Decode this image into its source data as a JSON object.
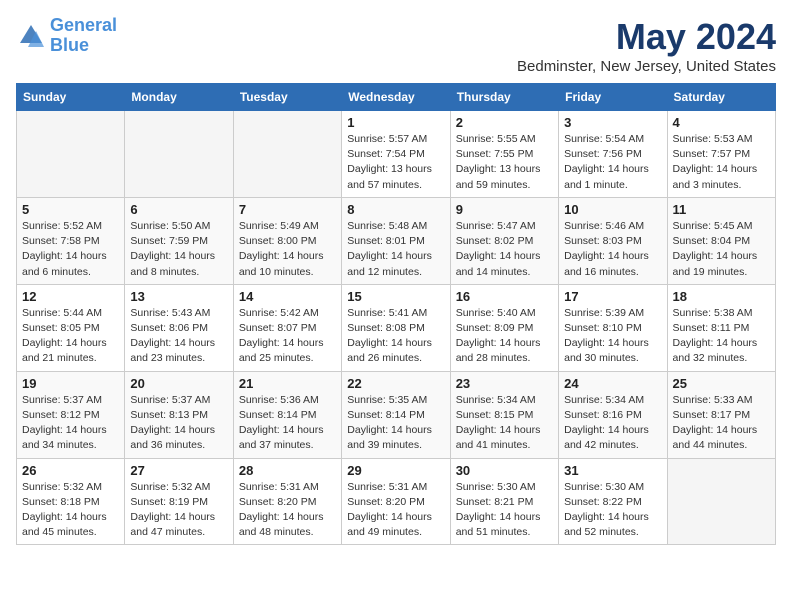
{
  "header": {
    "logo_line1": "General",
    "logo_line2": "Blue",
    "month": "May 2024",
    "location": "Bedminster, New Jersey, United States"
  },
  "weekdays": [
    "Sunday",
    "Monday",
    "Tuesday",
    "Wednesday",
    "Thursday",
    "Friday",
    "Saturday"
  ],
  "weeks": [
    [
      {
        "day": "",
        "info": ""
      },
      {
        "day": "",
        "info": ""
      },
      {
        "day": "",
        "info": ""
      },
      {
        "day": "1",
        "info": "Sunrise: 5:57 AM\nSunset: 7:54 PM\nDaylight: 13 hours\nand 57 minutes."
      },
      {
        "day": "2",
        "info": "Sunrise: 5:55 AM\nSunset: 7:55 PM\nDaylight: 13 hours\nand 59 minutes."
      },
      {
        "day": "3",
        "info": "Sunrise: 5:54 AM\nSunset: 7:56 PM\nDaylight: 14 hours\nand 1 minute."
      },
      {
        "day": "4",
        "info": "Sunrise: 5:53 AM\nSunset: 7:57 PM\nDaylight: 14 hours\nand 3 minutes."
      }
    ],
    [
      {
        "day": "5",
        "info": "Sunrise: 5:52 AM\nSunset: 7:58 PM\nDaylight: 14 hours\nand 6 minutes."
      },
      {
        "day": "6",
        "info": "Sunrise: 5:50 AM\nSunset: 7:59 PM\nDaylight: 14 hours\nand 8 minutes."
      },
      {
        "day": "7",
        "info": "Sunrise: 5:49 AM\nSunset: 8:00 PM\nDaylight: 14 hours\nand 10 minutes."
      },
      {
        "day": "8",
        "info": "Sunrise: 5:48 AM\nSunset: 8:01 PM\nDaylight: 14 hours\nand 12 minutes."
      },
      {
        "day": "9",
        "info": "Sunrise: 5:47 AM\nSunset: 8:02 PM\nDaylight: 14 hours\nand 14 minutes."
      },
      {
        "day": "10",
        "info": "Sunrise: 5:46 AM\nSunset: 8:03 PM\nDaylight: 14 hours\nand 16 minutes."
      },
      {
        "day": "11",
        "info": "Sunrise: 5:45 AM\nSunset: 8:04 PM\nDaylight: 14 hours\nand 19 minutes."
      }
    ],
    [
      {
        "day": "12",
        "info": "Sunrise: 5:44 AM\nSunset: 8:05 PM\nDaylight: 14 hours\nand 21 minutes."
      },
      {
        "day": "13",
        "info": "Sunrise: 5:43 AM\nSunset: 8:06 PM\nDaylight: 14 hours\nand 23 minutes."
      },
      {
        "day": "14",
        "info": "Sunrise: 5:42 AM\nSunset: 8:07 PM\nDaylight: 14 hours\nand 25 minutes."
      },
      {
        "day": "15",
        "info": "Sunrise: 5:41 AM\nSunset: 8:08 PM\nDaylight: 14 hours\nand 26 minutes."
      },
      {
        "day": "16",
        "info": "Sunrise: 5:40 AM\nSunset: 8:09 PM\nDaylight: 14 hours\nand 28 minutes."
      },
      {
        "day": "17",
        "info": "Sunrise: 5:39 AM\nSunset: 8:10 PM\nDaylight: 14 hours\nand 30 minutes."
      },
      {
        "day": "18",
        "info": "Sunrise: 5:38 AM\nSunset: 8:11 PM\nDaylight: 14 hours\nand 32 minutes."
      }
    ],
    [
      {
        "day": "19",
        "info": "Sunrise: 5:37 AM\nSunset: 8:12 PM\nDaylight: 14 hours\nand 34 minutes."
      },
      {
        "day": "20",
        "info": "Sunrise: 5:37 AM\nSunset: 8:13 PM\nDaylight: 14 hours\nand 36 minutes."
      },
      {
        "day": "21",
        "info": "Sunrise: 5:36 AM\nSunset: 8:14 PM\nDaylight: 14 hours\nand 37 minutes."
      },
      {
        "day": "22",
        "info": "Sunrise: 5:35 AM\nSunset: 8:14 PM\nDaylight: 14 hours\nand 39 minutes."
      },
      {
        "day": "23",
        "info": "Sunrise: 5:34 AM\nSunset: 8:15 PM\nDaylight: 14 hours\nand 41 minutes."
      },
      {
        "day": "24",
        "info": "Sunrise: 5:34 AM\nSunset: 8:16 PM\nDaylight: 14 hours\nand 42 minutes."
      },
      {
        "day": "25",
        "info": "Sunrise: 5:33 AM\nSunset: 8:17 PM\nDaylight: 14 hours\nand 44 minutes."
      }
    ],
    [
      {
        "day": "26",
        "info": "Sunrise: 5:32 AM\nSunset: 8:18 PM\nDaylight: 14 hours\nand 45 minutes."
      },
      {
        "day": "27",
        "info": "Sunrise: 5:32 AM\nSunset: 8:19 PM\nDaylight: 14 hours\nand 47 minutes."
      },
      {
        "day": "28",
        "info": "Sunrise: 5:31 AM\nSunset: 8:20 PM\nDaylight: 14 hours\nand 48 minutes."
      },
      {
        "day": "29",
        "info": "Sunrise: 5:31 AM\nSunset: 8:20 PM\nDaylight: 14 hours\nand 49 minutes."
      },
      {
        "day": "30",
        "info": "Sunrise: 5:30 AM\nSunset: 8:21 PM\nDaylight: 14 hours\nand 51 minutes."
      },
      {
        "day": "31",
        "info": "Sunrise: 5:30 AM\nSunset: 8:22 PM\nDaylight: 14 hours\nand 52 minutes."
      },
      {
        "day": "",
        "info": ""
      }
    ]
  ]
}
